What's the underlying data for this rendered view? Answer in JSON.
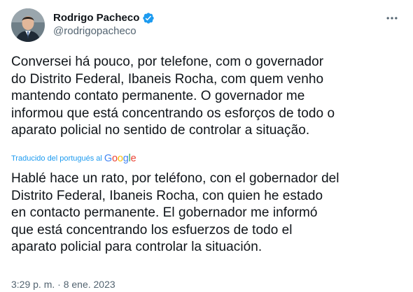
{
  "author": {
    "display_name": "Rodrigo Pacheco",
    "handle": "@rodrigopacheco",
    "verified": true
  },
  "tweet": {
    "original_text": "Conversei há pouco, por telefone, com o governador\ndo Distrito Federal, Ibaneis Rocha, com quem venho\nmantendo contato permanente. O governador me\ninformou que está concentrando os esforços de todo o\naparato policial no sentido de controlar a situação.",
    "translation_label": "Traducido del portugués al",
    "translation_provider": "Google",
    "translated_text": "Hablé hace un rato, por teléfono, con el gobernador del\nDistrito Federal, Ibaneis Rocha, con quien he estado\nen contacto permanente. El gobernador me informó\nque está concentrando los esfuerzos de todo el\naparato policial para controlar la situación.",
    "timestamp": "3:29 p. m. · 8 ene. 2023"
  },
  "icons": {
    "verified": "verified-badge-icon",
    "more": "more-options-icon"
  },
  "colors": {
    "accent": "#1d9bf0",
    "text_primary": "#0f1419",
    "text_secondary": "#536471",
    "google_blue": "#4285F4",
    "google_red": "#EA4335",
    "google_yellow": "#FBBC05",
    "google_green": "#34A853"
  }
}
